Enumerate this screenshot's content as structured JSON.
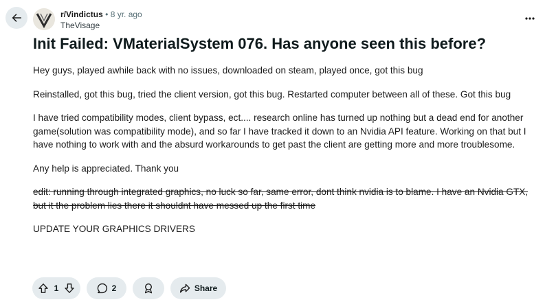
{
  "header": {
    "subreddit": "r/Vindictus",
    "separator": "•",
    "age": "8 yr. ago",
    "author": "TheVisage",
    "back_icon": "arrow-left-icon",
    "more_icon": "ellipsis-icon",
    "avatar_icon": "vindictus-v-logo"
  },
  "post": {
    "title": "Init Failed: VMaterialSystem 076. Has anyone seen this before?",
    "paragraphs": {
      "p1": "Hey guys, played awhile back with no issues, downloaded on steam, played once, got this bug",
      "p2": "Reinstalled, got this bug, tried the client version, got this bug. Restarted computer between all of these. Got this bug",
      "p3": "I have tried compatibility modes, client bypass, ect.... research online has turned up nothing but a dead end for another game(solution was compatibility mode), and so far I have tracked it down to an Nvidia API feature. Working on that but I have nothing to work with and the absurd workarounds to get past the client are getting more and more troublesome.",
      "p4": "Any help is appreciated. Thank you",
      "p5_strikethrough": "edit: running through integrated graphics, no luck so far, same error, dont think nvidia is to blame. I have an Nvidia GTX, but it the problem lies there it shouldnt have messed up the first time",
      "p6": "UPDATE YOUR GRAPHICS DRIVERS"
    }
  },
  "actions": {
    "vote_count": "1",
    "comment_count": "2",
    "share_label": "Share",
    "upvote_icon": "upvote-arrow-icon",
    "downvote_icon": "downvote-arrow-icon",
    "comment_icon": "comment-bubble-icon",
    "award_icon": "award-ribbon-icon",
    "share_icon": "share-arrow-icon"
  }
}
